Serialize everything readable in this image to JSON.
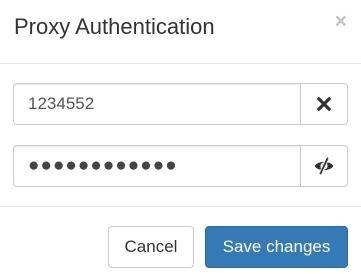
{
  "dialog": {
    "title": "Proxy Authentication",
    "close_glyph": "×",
    "close_icon": "close-icon"
  },
  "form": {
    "username": {
      "value": "1234552",
      "clear_icon": "clear-x-icon"
    },
    "password": {
      "masked_value": "●●●●●●●●●●●●",
      "toggle_icon": "eye-slash-icon"
    }
  },
  "footer": {
    "cancel_label": "Cancel",
    "save_label": "Save changes"
  },
  "colors": {
    "primary": "#337ab7",
    "border": "#cccccc",
    "text": "#333333"
  }
}
